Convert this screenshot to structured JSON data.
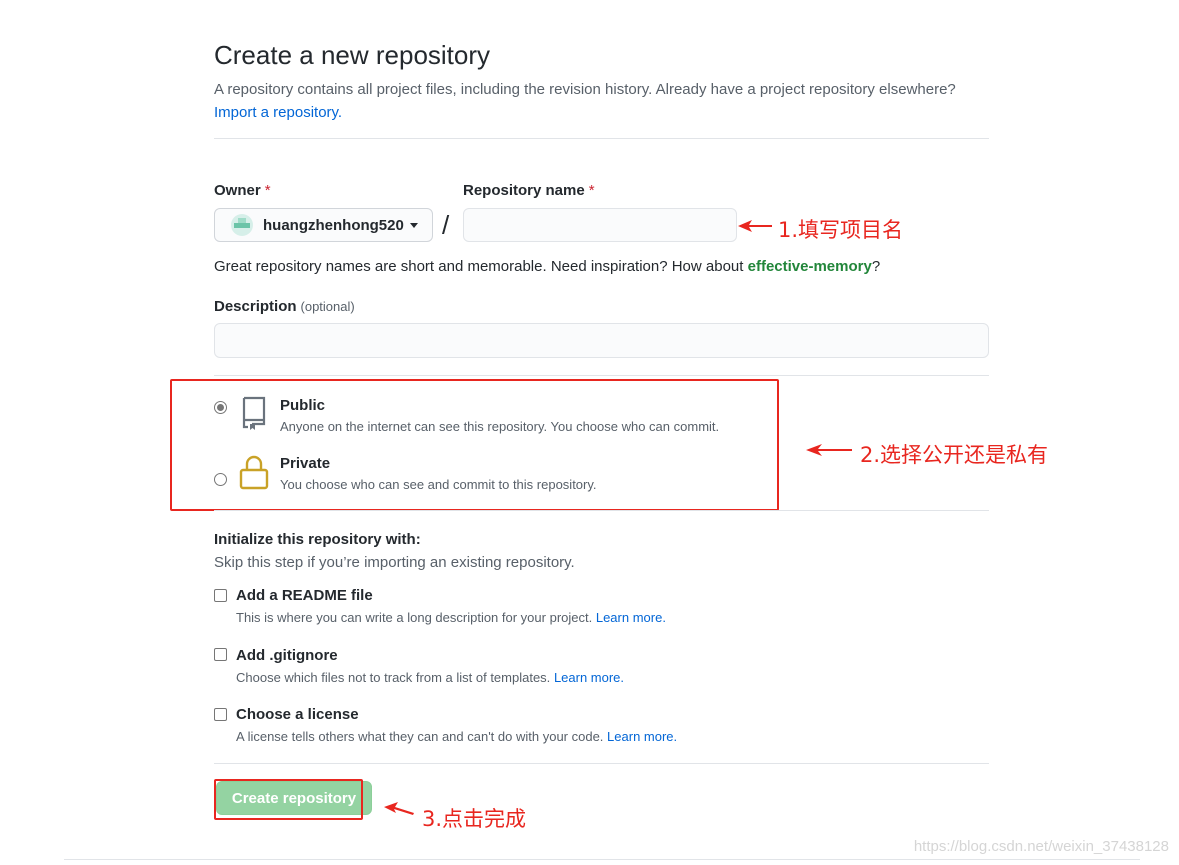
{
  "header": {
    "title": "Create a new repository",
    "description": "A repository contains all project files, including the revision history. Already have a project repository elsewhere?",
    "import_link": "Import a repository."
  },
  "owner": {
    "label": "Owner",
    "required_mark": "*",
    "value": "huangzhenhong520"
  },
  "repo_name": {
    "label": "Repository name",
    "required_mark": "*",
    "value": "",
    "separator": "/"
  },
  "hint": {
    "prefix": "Great repository names are short and memorable. Need inspiration? How about ",
    "suggestion": "effective-memory",
    "suffix": "?"
  },
  "description": {
    "label": "Description",
    "optional": "(optional)",
    "value": ""
  },
  "visibility": {
    "selected": "public",
    "public": {
      "title": "Public",
      "desc": "Anyone on the internet can see this repository. You choose who can commit."
    },
    "private": {
      "title": "Private",
      "desc": "You choose who can see and commit to this repository."
    }
  },
  "init": {
    "title": "Initialize this repository with:",
    "subtitle": "Skip this step if you’re importing an existing repository.",
    "readme": {
      "title": "Add a README file",
      "desc": "This is where you can write a long description for your project.",
      "link": "Learn more."
    },
    "gitignore": {
      "title": "Add .gitignore",
      "desc": "Choose which files not to track from a list of templates.",
      "link": "Learn more."
    },
    "license": {
      "title": "Choose a license",
      "desc": "A license tells others what they can and can't do with your code.",
      "link": "Learn more."
    }
  },
  "create_button": "Create repository",
  "annotations": {
    "step1": "1.填写项目名",
    "step2": "2.选择公开还是私有",
    "step3": "3.点击完成"
  },
  "watermark": "https://blog.csdn.net/weixin_37438128",
  "colors": {
    "link": "#0366d6",
    "suggestion": "#22863a",
    "required": "#cb2431",
    "create_button": "#94d3a2",
    "annotation_red": "#e8261f",
    "lock": "#c9a227"
  }
}
